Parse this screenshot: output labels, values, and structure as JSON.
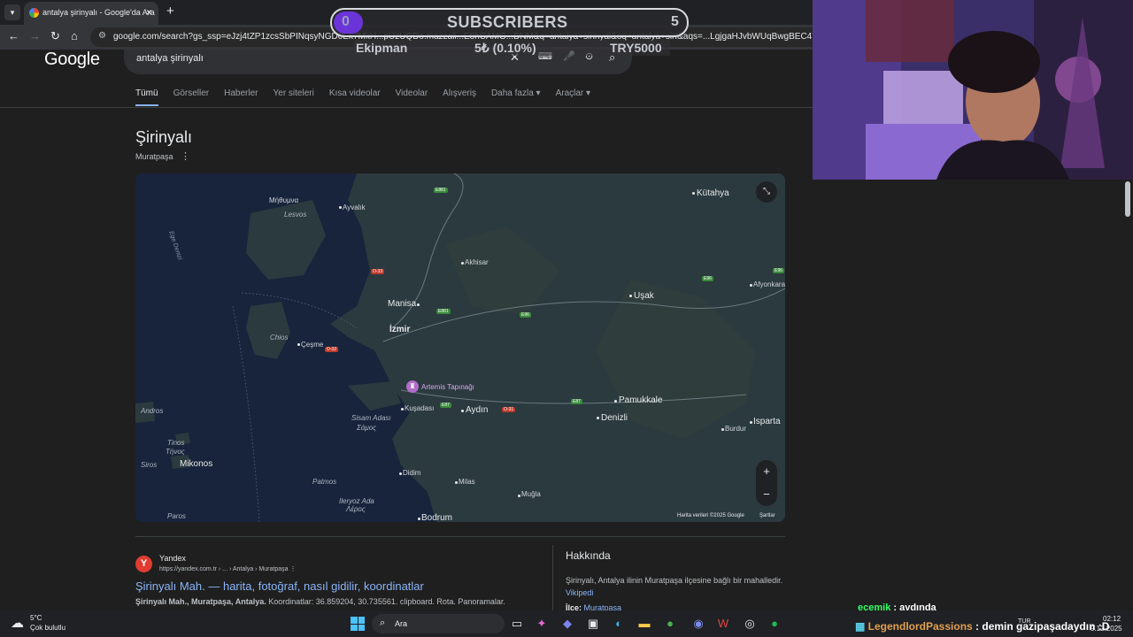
{
  "browser": {
    "tab_title": "antalya şirinyalı - Google'da Ara",
    "url": "google.com/search?gs_ssp=eJzj4tZP1zcsSbPINqsyNGD0Ek7MkH...pUzUQDo.mazzali...E8hCAMG...DNM&q=antalya+sirinyal&oq=antalya+sirİ&aqs=...LgjgaHJvbWUqBwgBEC4YgAQyBggAEEUYOTIHCAEQLhiABDIH"
  },
  "google": {
    "logo": "Google",
    "query": "antalya şirinyalı",
    "tabs": [
      "Tümü",
      "Görseller",
      "Haberler",
      "Yer siteleri",
      "Kısa videolar",
      "Videolar",
      "Alışveriş",
      "Daha fazla ▾",
      "Araçlar ▾"
    ]
  },
  "place": {
    "title": "Şirinyalı",
    "subtitle": "Muratpaşa"
  },
  "map": {
    "cities": {
      "kutahya": "Kütahya",
      "ayvalik": "Ayvalık",
      "akhisar": "Akhisar",
      "manisa": "Manisa",
      "izmir": "İzmir",
      "usak": "Uşak",
      "afyonkarahisar": "Afyonkarahisar",
      "cesme": "Çeşme",
      "kusadasi": "Kuşadası",
      "aydin": "Aydın",
      "pamukkale": "Pamukkale",
      "denizli": "Denizli",
      "isparta": "Isparta",
      "burdur": "Burdur",
      "didim": "Didim",
      "milas": "Milas",
      "mugla": "Muğla",
      "bodrum": "Bodrum"
    },
    "islands": {
      "mitilini": "Μήθυμνα",
      "lesvos": "Lesvos",
      "chios": "Chios",
      "samos_adasi": "Sisam Adası",
      "samos_gr": "Σάμος",
      "andros": "Andros",
      "tinos": "Tinos",
      "tinos_gr": "Τήνος",
      "mikonos": "Mikonos",
      "patmos": "Patmos",
      "leros": "Ileryoz Ada",
      "leros_gr": "Λέρος",
      "paros": "Paros",
      "siros": "Siros"
    },
    "sea": "Ege Denizi",
    "poi": "Artemis Tapınağı",
    "roads": {
      "o33": "O-33",
      "o32": "O-32",
      "o31": "O-31",
      "e881a": "E881",
      "e881b": "E881",
      "e96a": "E96",
      "e96b": "E96",
      "e96c": "E96",
      "e87a": "E87",
      "e87b": "E87"
    },
    "attribution": "Harita verileri ©2025 Google",
    "terms": "Şartlar",
    "zoom_in": "+",
    "zoom_out": "−"
  },
  "result": {
    "site_name": "Yandex",
    "site_url": "https://yandex.com.tr › ... › Antalya › Muratpaşa",
    "title": "Şirinyalı Mah. — harita, fotoğraf, nasıl gidilir, koordinatlar",
    "snippet_bold": "Şirinyalı Mah., Muratpaşa, Antalya.",
    "snippet": " Koordinatlar: 36.859204, 30.735561. clipboard. Rota. Panoramalar."
  },
  "about": {
    "heading": "Hakkında",
    "text": "Şirinyalı, Antalya ilinin Muratpaşa ilçesine bağlı bir mahalledir.",
    "link": "Vikipedi",
    "ilce_label": "İlçe:",
    "ilce_value": "Muratpaşa"
  },
  "overlay": {
    "sub_current": "0",
    "sub_label": "SUBSCRIBERS",
    "sub_goal": "5",
    "goal_name": "Ekipman",
    "goal_progress": "5₺ (0.10%)",
    "goal_target": "TRY5000"
  },
  "chat": [
    {
      "user": "ecemik",
      "msg": " : aydında"
    },
    {
      "user": "LegendlordPassions",
      "msg": " : demin gazipaşadaydın :D"
    }
  ],
  "taskbar": {
    "temp": "5°C",
    "weather": "Çok bulutlu",
    "search": "Ara",
    "lang": "TUR",
    "time": "02:12",
    "date": "9.12.2025"
  },
  "colors": {
    "accent": "#8ab4f8",
    "sub_fill": "#6a34d8",
    "chat_user1": "#33ff66",
    "chat_user2": "#e0a050"
  }
}
